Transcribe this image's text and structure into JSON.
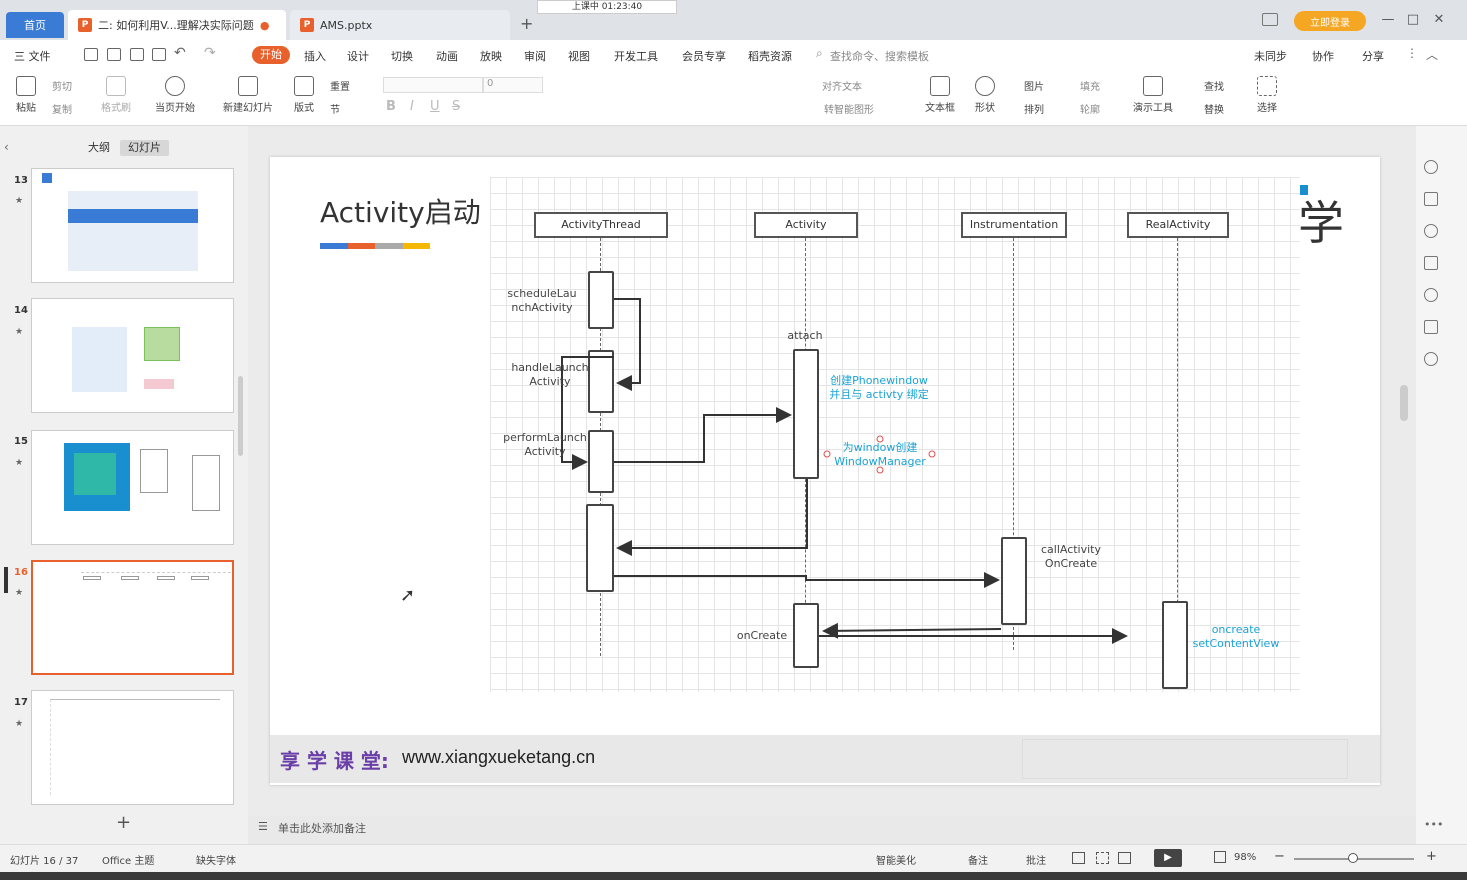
{
  "titlebar": {
    "home_tab": "首页",
    "doc1_tab": "二: 如何利用V...理解决实际问题",
    "doc1_icon": "P",
    "doc2_tab": "AMS.pptx",
    "doc2_icon": "P",
    "new_tab": "+",
    "recording": "上课中 01:23:40",
    "login": "立即登录"
  },
  "menu": {
    "file": "三 文件",
    "items": [
      "开始",
      "插入",
      "设计",
      "切换",
      "动画",
      "放映",
      "审阅",
      "视图",
      "开发工具",
      "会员专享",
      "稻壳资源"
    ],
    "search": "查找命令、搜索模板",
    "sync": "未同步",
    "collab": "协作",
    "share": "分享"
  },
  "ribbon": {
    "paste": "粘贴",
    "cut": "剪切",
    "copy": "复制",
    "format_painter": "格式刷",
    "from_current": "当页开始",
    "new_slide": "新建幻灯片",
    "layout": "版式",
    "reset": "重置",
    "section": "节",
    "font_size": "0",
    "text_box": "文本框",
    "shape": "形状",
    "picture": "图片",
    "arrange": "排列",
    "fill": "填充",
    "outline": "轮廓",
    "presenter": "演示工具",
    "find": "查找",
    "replace": "替换",
    "select": "选择",
    "align_text": "对齐文本",
    "smart_art": "转智能图形"
  },
  "leftpanel": {
    "tab_outline": "大纲",
    "tab_slides": "幻灯片",
    "slides": [
      {
        "num": "13"
      },
      {
        "num": "14"
      },
      {
        "num": "15"
      },
      {
        "num": "16"
      },
      {
        "num": "17"
      }
    ],
    "add": "+"
  },
  "slide": {
    "title": "Activity启动",
    "title_bar_colors": [
      "#3a7bd5",
      "#e8612c",
      "#aaaaaa",
      "#f5b800"
    ],
    "lifelines": [
      "ActivityThread",
      "Activity",
      "Instrumentation",
      "RealActivity"
    ],
    "labels": {
      "schedule": "scheduleLau\nnchActivity",
      "handle": "handleLaunch\nActivity",
      "perform": "performLaunch\nActivity",
      "attach": "attach",
      "oncreate": "onCreate",
      "callactivity": "callActivity\nOnCreate"
    },
    "notes_cyan": {
      "create_window": "创建Phonewindow\n并且与 activty 绑定",
      "window_manager": "为window创建\nWindowManager",
      "setcontent": "oncreate\nsetContentView"
    },
    "logo_char": "学",
    "footer_brand": "享 学 课 堂:",
    "footer_url": "www.xiangxueketang.cn"
  },
  "notes_placeholder": "单击此处添加备注",
  "status": {
    "slide_pos": "幻灯片 16 / 37",
    "theme": "Office 主题",
    "missing_font": "缺失字体",
    "smart_beautify": "智能美化",
    "notes": "备注",
    "comments": "批注",
    "zoom": "98%"
  },
  "colors": {
    "accent": "#e8612c",
    "blue": "#3a7bd5",
    "cyan": "#1aa3d6"
  }
}
